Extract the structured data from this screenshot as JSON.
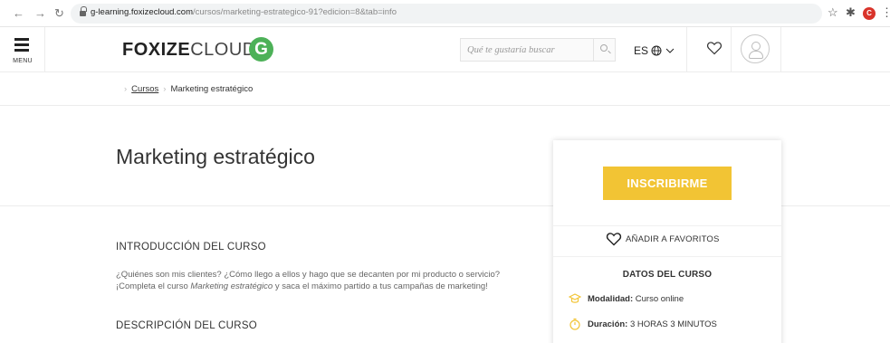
{
  "browser": {
    "back_icon": "arrow-left-icon",
    "forward_icon": "arrow-right-icon",
    "reload_icon": "reload-icon",
    "url_host": "g-learning.foxizecloud.com",
    "url_path": "/cursos/marketing-estrategico-91?edicion=8&tab=info",
    "profile_initial": "C",
    "profile_color": "#d9342b"
  },
  "header": {
    "menu_label": "MENU",
    "logo_bold": "FOXIZE",
    "logo_light": "CLOUD",
    "logo_sep": "|",
    "logo_badge": "G",
    "logo_badge_color": "#4db158",
    "search_placeholder": "Qué te gustaría buscar",
    "lang": "ES",
    "lang_icons": [
      "globe-icon",
      "chevron-down-icon"
    ]
  },
  "breadcrumb": {
    "items": [
      "Cursos",
      "Marketing estratégico"
    ]
  },
  "main": {
    "title": "Marketing estratégico",
    "intro_heading": "INTRODUCCIÓN DEL CURSO",
    "intro_p1": "¿Quiénes son mis clientes? ¿Cómo llego a ellos y hago que se decanten por mi producto o servicio?",
    "intro_p2_pre": "¡Completa el curso ",
    "intro_p2_em": "Marketing estratégico",
    "intro_p2_post": " y saca el máximo partido a tus campañas de marketing!",
    "desc_heading": "DESCRIPCIÓN DEL CURSO"
  },
  "sidebar": {
    "enroll_label": "INSCRIBIRME",
    "enroll_color": "#f2c434",
    "fav_label": "AÑADIR A FAVORITOS",
    "datos_title": "DATOS DEL CURSO",
    "modalidad_label": "Modalidad:",
    "modalidad_value": "Curso online",
    "duracion_label": "Duración:",
    "duracion_value": "3 HORAS 3 MINUTOS",
    "icon_color": "#f2c434"
  }
}
